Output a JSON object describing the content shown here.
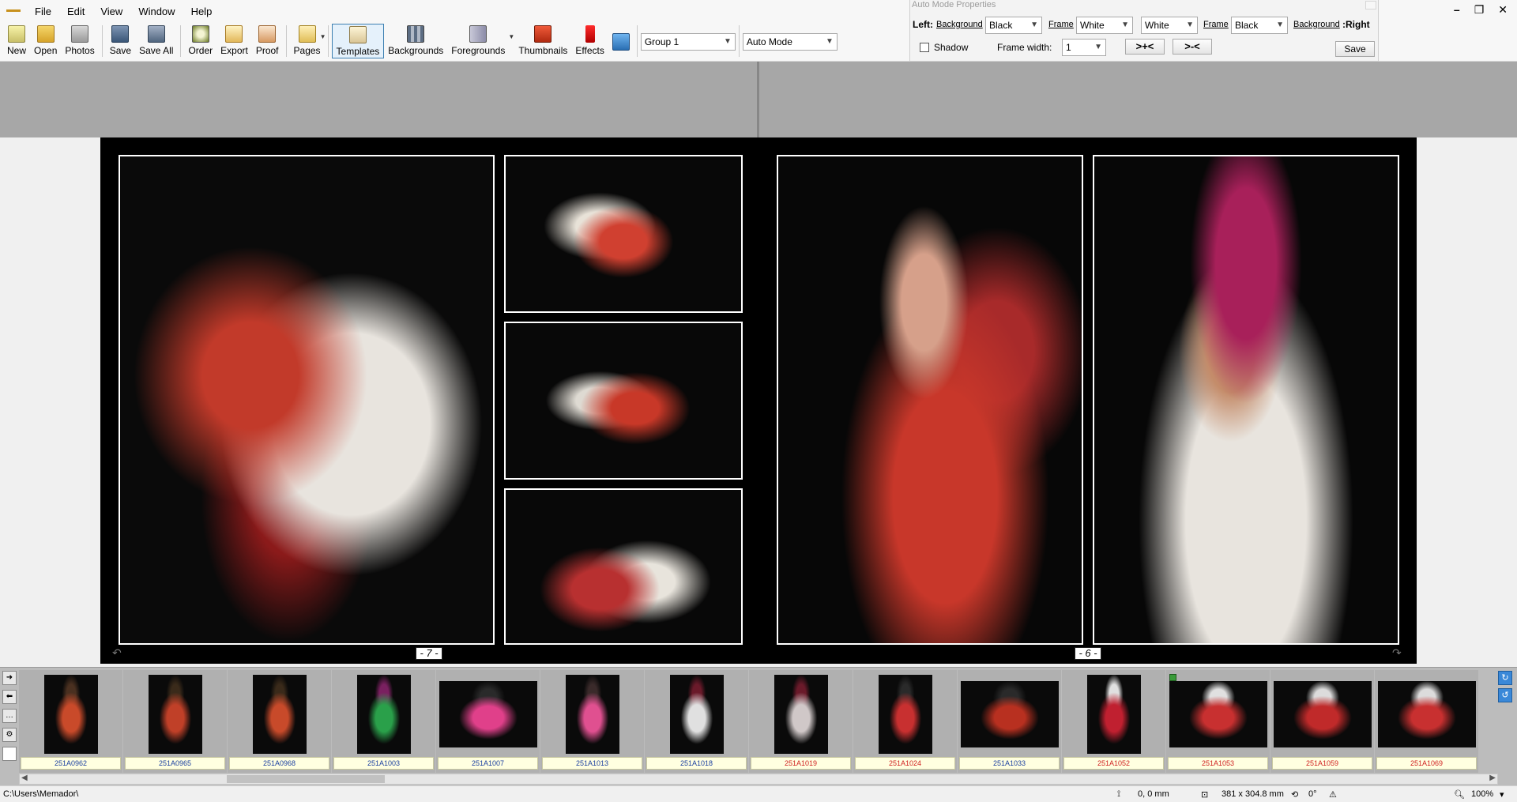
{
  "menu": [
    "File",
    "Edit",
    "View",
    "Window",
    "Help"
  ],
  "toolbar": {
    "buttons": [
      "New",
      "Open",
      "Photos",
      "Save",
      "Save All",
      "Order",
      "Export",
      "Proof",
      "Pages",
      "Templates",
      "Backgrounds",
      "Foregrounds",
      "Thumbnails",
      "Effects"
    ],
    "active": "Templates",
    "group_select": "Group 1",
    "mode_select": "Auto Mode"
  },
  "amp": {
    "title": "Auto Mode Properties",
    "left_label": "Left:",
    "background_label": "Background",
    "frame_label": "Frame",
    "left_bg_value": "Black",
    "left_frame_value": "White",
    "right_frame_value": "White",
    "right_bg_value": "Black",
    "right_label": ":Right",
    "shadow_label": "Shadow",
    "frame_width_label": "Frame width:",
    "frame_width_value": "1",
    "expand_btn": ">+<",
    "shrink_btn": ">-<",
    "save_btn": "Save"
  },
  "pages": {
    "left_number": "- 7 -",
    "right_number": "- 6 -"
  },
  "thumbnails": [
    {
      "label": "251A0962",
      "red": false
    },
    {
      "label": "251A0965",
      "red": false
    },
    {
      "label": "251A0968",
      "red": false
    },
    {
      "label": "251A1003",
      "red": false
    },
    {
      "label": "251A1007",
      "red": false
    },
    {
      "label": "251A1013",
      "red": false
    },
    {
      "label": "251A1018",
      "red": false
    },
    {
      "label": "251A1019",
      "red": true
    },
    {
      "label": "251A1024",
      "red": true
    },
    {
      "label": "251A1033",
      "red": false
    },
    {
      "label": "251A1052",
      "red": true
    },
    {
      "label": "251A1053",
      "red": true
    },
    {
      "label": "251A1059",
      "red": true
    },
    {
      "label": "251A1069",
      "red": true
    }
  ],
  "status": {
    "path": "C:\\Users\\Memador\\",
    "position": "0, 0 mm",
    "size": "381 x 304.8 mm",
    "rotation": "0°",
    "zoom": "100%"
  }
}
